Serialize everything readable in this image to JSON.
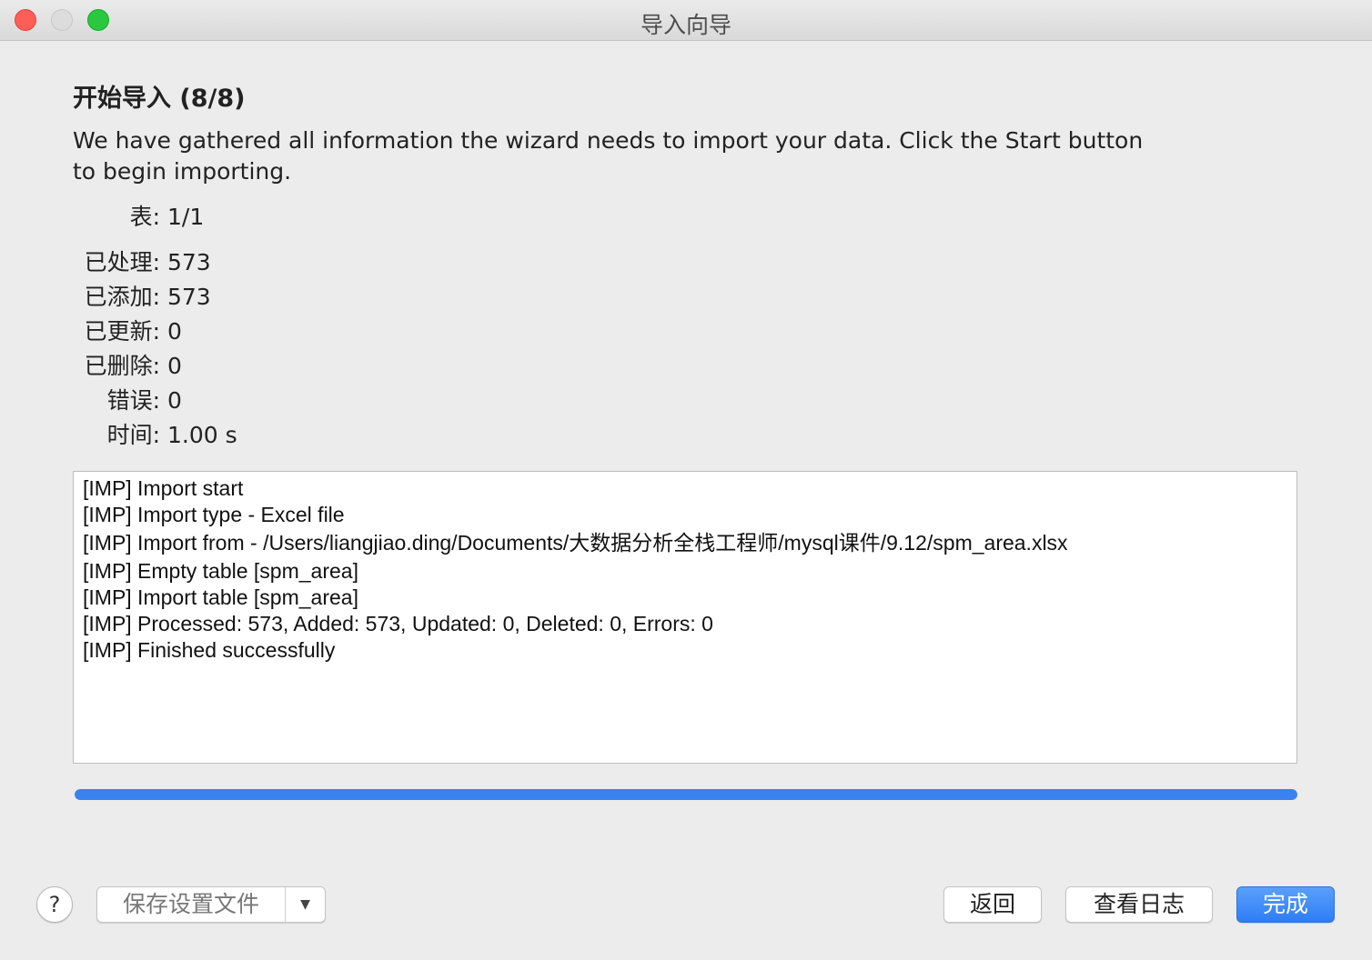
{
  "window": {
    "title": "导入向导"
  },
  "heading": "开始导入 (8/8)",
  "description": "We have gathered all information the wizard needs to import your data. Click the Start button to begin importing.",
  "stats": [
    {
      "label": "表:",
      "value": "1/1"
    },
    {
      "label": "已处理:",
      "value": "573"
    },
    {
      "label": "已添加:",
      "value": "573"
    },
    {
      "label": "已更新:",
      "value": "0"
    },
    {
      "label": "已删除:",
      "value": "0"
    },
    {
      "label": "错误:",
      "value": "0"
    },
    {
      "label": "时间:",
      "value": "1.00 s"
    }
  ],
  "log": [
    "[IMP] Import start",
    "[IMP] Import type - Excel file",
    "[IMP] Import from - /Users/liangjiao.ding/Documents/大数据分析全栈工程师/mysql课件/9.12/spm_area.xlsx",
    "[IMP] Empty table [spm_area]",
    "[IMP] Import table [spm_area]",
    "[IMP] Processed: 573, Added: 573, Updated: 0, Deleted: 0, Errors: 0",
    "[IMP] Finished successfully"
  ],
  "progress": {
    "percent": 100,
    "color": "#3a82f0"
  },
  "footer": {
    "help_label": "?",
    "save_settings_label": "保存设置文件",
    "save_dropdown_glyph": "▼",
    "back_label": "返回",
    "view_log_label": "查看日志",
    "done_label": "完成"
  }
}
